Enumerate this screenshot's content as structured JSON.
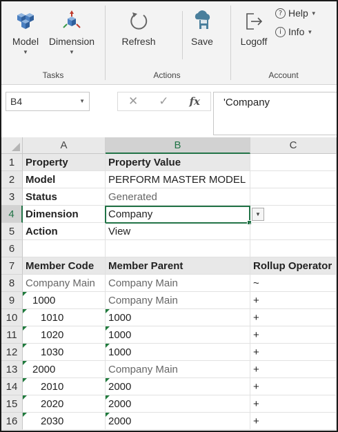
{
  "ribbon": {
    "model_label": "Model",
    "dimension_label": "Dimension",
    "refresh_label": "Refresh",
    "save_label": "Save",
    "logoff_label": "Logoff",
    "help_label": "Help",
    "info_label": "Info",
    "groups": {
      "tasks": "Tasks",
      "actions": "Actions",
      "account": "Account"
    }
  },
  "formula_bar": {
    "name_box": "B4",
    "fx_symbol": "fx",
    "content": "'Company"
  },
  "columns": [
    "A",
    "B",
    "C"
  ],
  "rows": [
    {
      "num": "1",
      "a": "Property",
      "b": "Property Value",
      "c": ""
    },
    {
      "num": "2",
      "a": "Model",
      "b": "PERFORM MASTER MODEL",
      "c": ""
    },
    {
      "num": "3",
      "a": "Status",
      "b": "Generated",
      "c": ""
    },
    {
      "num": "4",
      "a": "Dimension",
      "b": "Company",
      "c": ""
    },
    {
      "num": "5",
      "a": "Action",
      "b": "View",
      "c": ""
    },
    {
      "num": "6",
      "a": "",
      "b": "",
      "c": ""
    },
    {
      "num": "7",
      "a": "Member Code",
      "b": "Member Parent",
      "c": "Rollup Operator"
    },
    {
      "num": "8",
      "a": "Company Main",
      "b": "Company Main",
      "c": "~"
    },
    {
      "num": "9",
      "a": "1000",
      "b": "Company Main",
      "c": "+"
    },
    {
      "num": "10",
      "a": "1010",
      "b": "1000",
      "c": "+"
    },
    {
      "num": "11",
      "a": "1020",
      "b": "1000",
      "c": "+"
    },
    {
      "num": "12",
      "a": "1030",
      "b": "1000",
      "c": "+"
    },
    {
      "num": "13",
      "a": "2000",
      "b": "Company Main",
      "c": "+"
    },
    {
      "num": "14",
      "a": "2010",
      "b": "2000",
      "c": "+"
    },
    {
      "num": "15",
      "a": "2020",
      "b": "2000",
      "c": "+"
    },
    {
      "num": "16",
      "a": "2030",
      "b": "2000",
      "c": "+"
    }
  ],
  "selected_cell": "B4",
  "colors": {
    "accent": "#217346",
    "error_triangle": "#1f7a3c"
  }
}
